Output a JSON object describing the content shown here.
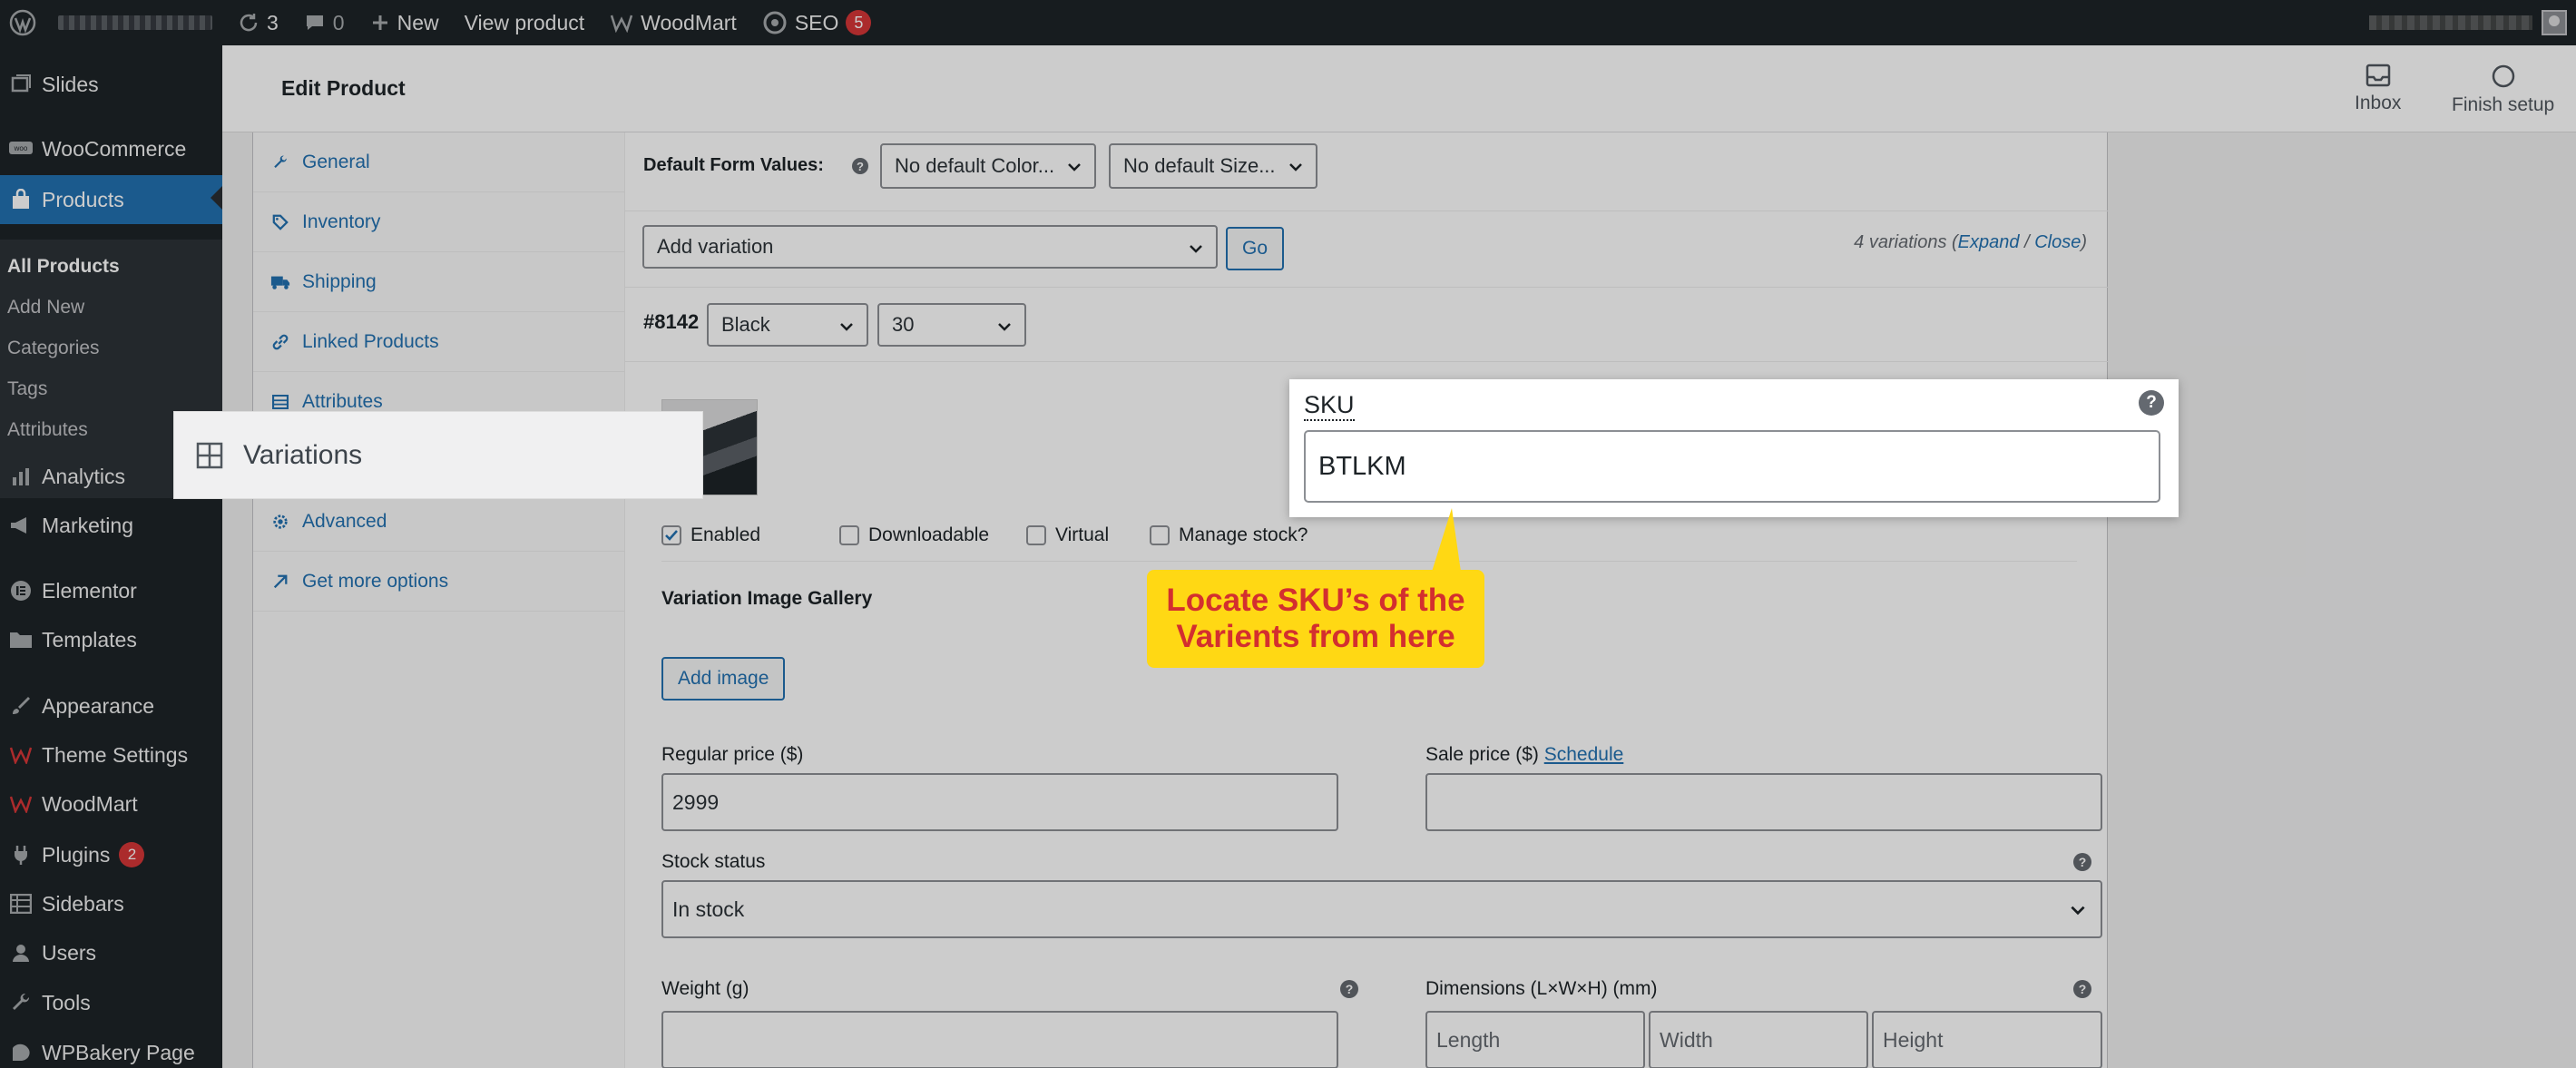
{
  "adminbar": {
    "updates_count": "3",
    "comments_count": "0",
    "new_label": "New",
    "view_product_label": "View product",
    "woodmart_label": "WoodMart",
    "seo_label": "SEO",
    "seo_badge": "5"
  },
  "sidebar": {
    "items": [
      {
        "label": "Slides",
        "icon": "slides-icon"
      },
      {
        "label": "WooCommerce",
        "icon": "woocommerce-icon"
      },
      {
        "label": "Products",
        "icon": "products-icon",
        "active": true
      },
      {
        "label": "Analytics",
        "icon": "analytics-icon"
      },
      {
        "label": "Marketing",
        "icon": "megaphone-icon"
      },
      {
        "label": "Elementor",
        "icon": "elementor-icon"
      },
      {
        "label": "Templates",
        "icon": "folder-icon"
      },
      {
        "label": "Appearance",
        "icon": "brush-icon"
      },
      {
        "label": "Theme Settings",
        "icon": "theme-settings-icon"
      },
      {
        "label": "WoodMart",
        "icon": "woodmart-icon"
      },
      {
        "label": "Plugins",
        "icon": "plugin-icon",
        "badge": "2"
      },
      {
        "label": "Sidebars",
        "icon": "sidebars-icon"
      },
      {
        "label": "Users",
        "icon": "user-icon"
      },
      {
        "label": "Tools",
        "icon": "wrench-icon"
      },
      {
        "label": "WPBakery Page",
        "icon": "wpbakery-icon"
      }
    ],
    "submenu": [
      "All Products",
      "Add New",
      "Categories",
      "Tags",
      "Attributes"
    ]
  },
  "header": {
    "title": "Edit Product",
    "inbox_label": "Inbox",
    "finish_setup_label": "Finish setup"
  },
  "tabs": [
    "General",
    "Inventory",
    "Shipping",
    "Linked Products",
    "Attributes",
    "Variations",
    "Advanced",
    "Get more options"
  ],
  "variations": {
    "default_form_label": "Default Form Values:",
    "default_color": "No default Color...",
    "default_size": "No default Size...",
    "add_variation": "Add variation",
    "go_label": "Go",
    "count_text": "4 variations (",
    "expand_label": "Expand",
    "slash": " / ",
    "close_label": "Close",
    "close_paren": ")",
    "variation_id": "#8142",
    "color_value": "Black",
    "size_value": "30",
    "sku_label": "SKU",
    "sku_value": "BTLKM",
    "enabled_label": "Enabled",
    "downloadable_label": "Downloadable",
    "virtual_label": "Virtual",
    "manage_stock_label": "Manage stock?",
    "gallery_label": "Variation Image Gallery",
    "add_image_label": "Add image",
    "regular_price_label": "Regular price ($)",
    "regular_price_value": "2999",
    "sale_price_label": "Sale price ($)",
    "schedule_label": "Schedule",
    "stock_status_label": "Stock status",
    "stock_status_value": "In stock",
    "weight_label": "Weight (g)",
    "dimensions_label": "Dimensions (L×W×H) (mm)",
    "length_placeholder": "Length",
    "width_placeholder": "Width",
    "height_placeholder": "Height",
    "help_glyph": "?"
  },
  "callout": {
    "line1": "Locate SKU’s of the",
    "line2": "Varients from here"
  },
  "colors": {
    "admin_dark": "#1d2327",
    "wp_blue": "#2271b1",
    "callout_yellow": "#ffd814",
    "callout_red": "#d32f2f",
    "badge_red": "#d63638"
  }
}
